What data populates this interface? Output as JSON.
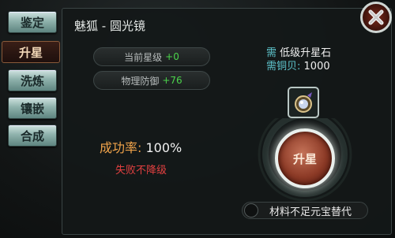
{
  "sidebar": {
    "tabs": [
      {
        "label": "鉴定",
        "active": false
      },
      {
        "label": "升星",
        "active": true
      },
      {
        "label": "洗炼",
        "active": false
      },
      {
        "label": "镶嵌",
        "active": false
      },
      {
        "label": "合成",
        "active": false
      }
    ]
  },
  "panel": {
    "title": "魅狐 - 圆光镜"
  },
  "stats": [
    {
      "label": "当前星级",
      "value": "+0"
    },
    {
      "label": "物理防御",
      "value": "+76"
    }
  ],
  "success": {
    "label": "成功率:",
    "value": "100%"
  },
  "warning": "失败不降级",
  "requirements": [
    {
      "prefix": "需",
      "value": "低级升星石"
    },
    {
      "prefix": "需铜贝:",
      "value": "1000"
    }
  ],
  "star_button": {
    "label": "升星"
  },
  "substitute": {
    "label": "材料不足元宝替代",
    "checked": false
  },
  "icons": {
    "close": "close-icon",
    "item": "mirror-item-icon"
  },
  "colors": {
    "stat_value": "#4bd44b",
    "success_label": "#f0a34a",
    "warning": "#e24040",
    "requirement_label": "#5fc7cf"
  }
}
